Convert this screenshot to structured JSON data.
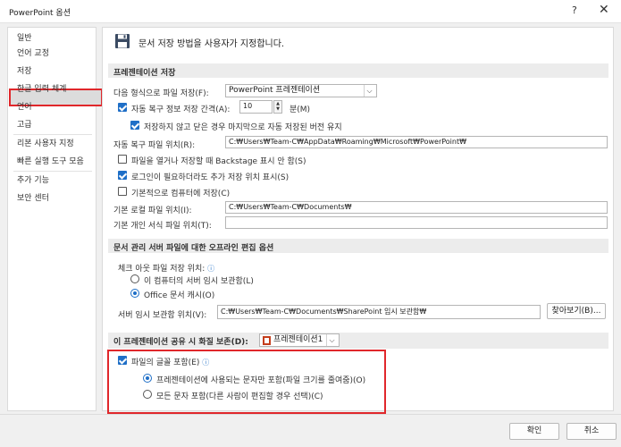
{
  "window": {
    "title": "PowerPoint 옵션",
    "help": "?",
    "close": "✕"
  },
  "sidebar": {
    "items": [
      {
        "label": "일반"
      },
      {
        "label": "언어 교정"
      },
      {
        "label": "저장"
      },
      {
        "label": "한글 입력 체계"
      },
      {
        "label": "언어"
      },
      {
        "label": "고급"
      },
      {
        "label": "리본 사용자 지정"
      },
      {
        "label": "빠른 실행 도구 모음"
      },
      {
        "label": "추가 기능"
      },
      {
        "label": "보안 센터"
      }
    ],
    "selected": "저장"
  },
  "header": {
    "text": "문서 저장 방법을 사용자가 지정합니다."
  },
  "save_section": {
    "title": "프레젠테이션 저장",
    "format_label": "다음 형식으로 파일 저장(F):",
    "format_value": "PowerPoint 프레젠테이션",
    "autorecover_label": "자동 복구 정보 저장 간격(A):",
    "autorecover_value": "10",
    "minutes_label": "분(M)",
    "keep_last_label": "저장하지 않고 닫은 경우 마지막으로 자동 저장된 버전 유지",
    "autorecover_location_label": "자동 복구 파일 위치(R):",
    "autorecover_location_value": "C:₩Users₩Team-C₩AppData₩Roaming₩Microsoft₩PowerPoint₩",
    "backstage_label": "파일을 열거나 저장할 때 Backstage 표시 안 함(S)",
    "show_locations_label": "로그인이 필요하더라도 추가 저장 위치 표시(S)",
    "default_computer_label": "기본적으로 컴퓨터에 저장(C)",
    "local_location_label": "기본 로컬 파일 위치(I):",
    "local_location_value": "C:₩Users₩Team-C₩Documents₩",
    "personal_templates_label": "기본 개인 서식 파일 위치(T):",
    "personal_templates_value": ""
  },
  "offline_section": {
    "title": "문서 관리 서버 파일에 대한 오프라인 편집 옵션",
    "checkout_label": "체크 아웃 파일 저장 위치:",
    "radio_server_drafts": "이 컴퓨터의 서버 임시 보관함(L)",
    "radio_office_cache": "Office 문서 캐시(O)",
    "server_drafts_label": "서버 임시 보관함 위치(V):",
    "server_drafts_value": "C:₩Users₩Team-C₩Documents₩SharePoint 임시 보관함₩",
    "browse_label": "찾아보기(B)..."
  },
  "fidelity_section": {
    "title": "이 프레젠테이션 공유 시 화질 보존(D):",
    "presentation_value": "프레젠테이션1",
    "embed_fonts_label": "파일의 글꼴 포함(E)",
    "radio_used_chars": "프레젠테이션에 사용되는 문자만 포함(파일 크기를 줄여줌)(O)",
    "radio_all_chars": "모든 문자 포함(다른 사람이 편집할 경우 선택)(C)"
  },
  "footer": {
    "ok": "확인",
    "cancel": "취소"
  },
  "colors": {
    "accent": "#1f6fc7",
    "highlight": "#e0272b"
  }
}
